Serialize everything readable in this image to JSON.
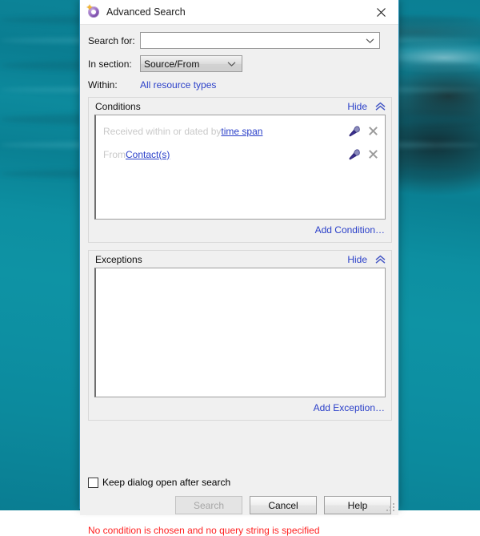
{
  "window": {
    "title": "Advanced Search",
    "icon": "advanced-search-icon",
    "close_label": "✕"
  },
  "form": {
    "search_for_label": "Search for:",
    "search_for_value": "",
    "search_for_placeholder": "",
    "in_section_label": "In section:",
    "in_section_value": "Source/From",
    "in_section_options": [
      "Source/From"
    ],
    "within_label": "Within:",
    "within_value": "All resource types"
  },
  "conditions": {
    "title": "Conditions",
    "hide_label": "Hide",
    "collapse_icon": "chevron-double-up-icon",
    "rows": [
      {
        "prefix": "Received within or dated by ",
        "link": "time span",
        "edit_icon": "lens-icon",
        "remove_icon": "close-icon"
      },
      {
        "prefix": "From ",
        "link": "Contact(s)",
        "edit_icon": "lens-icon",
        "remove_icon": "close-icon"
      }
    ],
    "add_label": "Add Condition…"
  },
  "exceptions": {
    "title": "Exceptions",
    "hide_label": "Hide",
    "collapse_icon": "chevron-double-up-icon",
    "rows": [],
    "add_label": "Add Exception…"
  },
  "options": {
    "keep_open_label": "Keep dialog open after search",
    "keep_open_checked": false
  },
  "buttons": {
    "search": "Search",
    "search_enabled": false,
    "cancel": "Cancel",
    "help": "Help"
  },
  "status": {
    "message": "No condition is chosen and no query string is specified",
    "color": "#ff1f1f"
  },
  "colors": {
    "link": "#2b40c9",
    "dialog_border": "#2a8fb8",
    "dialog_bg": "#f0f0f0",
    "placeholder_text": "#c9c9c9",
    "wallpaper": "#0d8fa1"
  }
}
